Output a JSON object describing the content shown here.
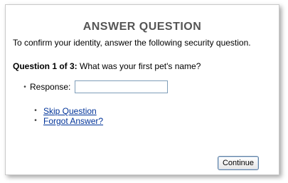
{
  "dialog": {
    "title": "ANSWER QUESTION",
    "subtitle": "To confirm your identity, answer the following security question."
  },
  "question": {
    "counter": "Question 1 of 3:",
    "text": "What was your first pet's name?"
  },
  "response": {
    "bullet": "•",
    "label": "Response:",
    "value": "",
    "placeholder": ""
  },
  "links": [
    {
      "bullet": "•",
      "label": "Skip Question"
    },
    {
      "bullet": "•",
      "label": "Forgot Answer?"
    }
  ],
  "buttons": {
    "continue_label": "Continue"
  }
}
